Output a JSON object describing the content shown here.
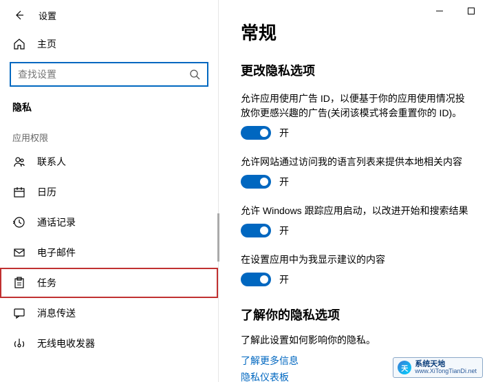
{
  "window": {
    "back_title": "设置"
  },
  "sidebar": {
    "home_label": "主页",
    "search_placeholder": "查找设置",
    "category_title": "隐私",
    "subsection_title": "应用权限",
    "items": [
      {
        "label": "联系人"
      },
      {
        "label": "日历"
      },
      {
        "label": "通话记录"
      },
      {
        "label": "电子邮件"
      },
      {
        "label": "任务"
      },
      {
        "label": "消息传送"
      },
      {
        "label": "无线电收发器"
      }
    ]
  },
  "main": {
    "heading": "常规",
    "section_heading": "更改隐私选项",
    "settings": [
      {
        "desc": "允许应用使用广告 ID，以便基于你的应用使用情况投放你更感兴趣的广告(关闭该模式将会重置你的 ID)。",
        "state_label": "开"
      },
      {
        "desc": "允许网站通过访问我的语言列表来提供本地相关内容",
        "state_label": "开"
      },
      {
        "desc": "允许 Windows 跟踪应用启动，以改进开始和搜索结果",
        "state_label": "开"
      },
      {
        "desc": "在设置应用中为我显示建议的内容",
        "state_label": "开"
      }
    ],
    "learn": {
      "heading": "了解你的隐私选项",
      "text": "了解此设置如何影响你的隐私。",
      "link1": "了解更多信息",
      "link2": "隐私仪表板"
    }
  },
  "watermark": {
    "name": "系统天地",
    "url": "www.XiTongTianDi.net"
  }
}
